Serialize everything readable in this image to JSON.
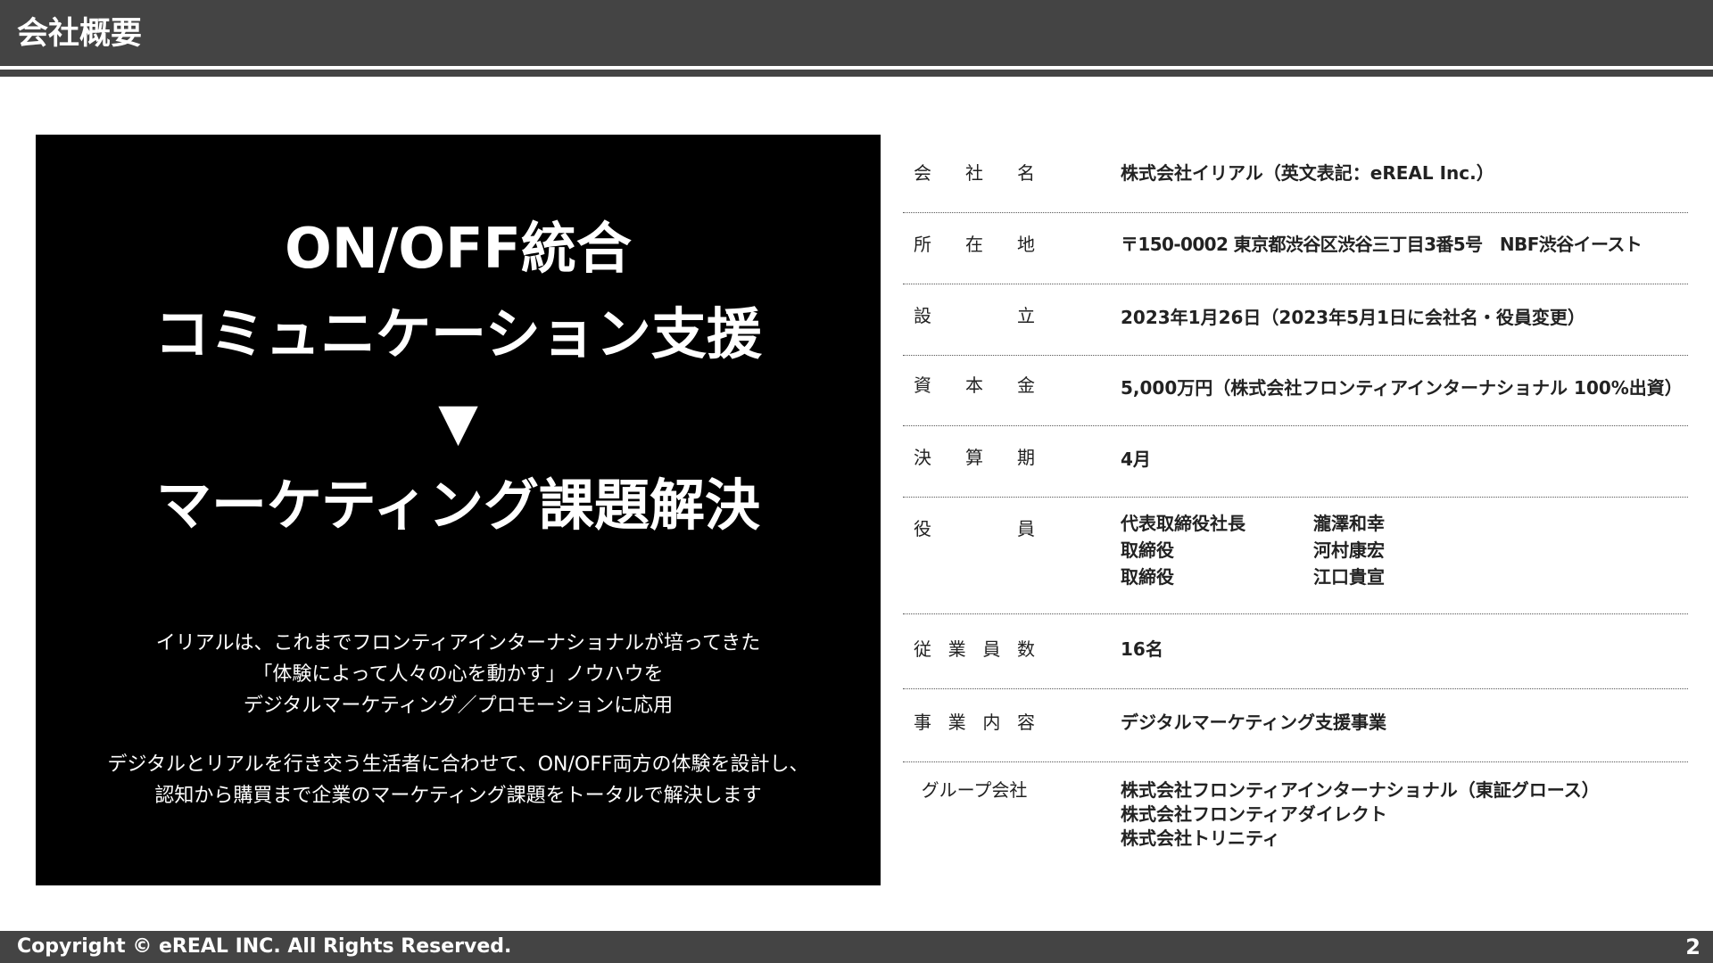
{
  "header": {
    "title": "会社概要"
  },
  "hero": {
    "headline_1": "ON/OFF統合",
    "headline_2": "コミュニケーション支援",
    "arrow": "▼",
    "headline_3": "マーケティング課題解決",
    "description": [
      "イリアルは、これまでフロンティアインターナショナルが培ってきた",
      "「体験によって人々の心を動かす」ノウハウを",
      "デジタルマーケティング／プロモーションに応用",
      "デジタルとリアルを行き交う生活者に合わせて、ON/OFF両方の体験を設計し、",
      "認知から購買まで企業のマーケティング課題をトータルで解決します"
    ]
  },
  "company_info": {
    "company_name": {
      "label": "会 社 名",
      "value": "株式会社イリアル（英文表記：eREAL Inc.）"
    },
    "address": {
      "label": "所 在 地",
      "value": "〒150-0002 東京都渋谷区渋谷三丁目3番5号　NBF渋谷イースト"
    },
    "established": {
      "label": "設 立",
      "value": "2023年1月26日（2023年5月1日に会社名・役員変更）"
    },
    "capital": {
      "label": "資 本 金",
      "value": "5,000万円（株式会社フロンティアインターナショナル 100%出資）"
    },
    "fiscal_period": {
      "label": "決 算 期",
      "value": "4月"
    },
    "officers": {
      "label": "役 員",
      "members": [
        {
          "role": "代表取締役社長",
          "name": "瀧澤和幸"
        },
        {
          "role": "取締役",
          "name": "河村康宏"
        },
        {
          "role": "取締役",
          "name": "江口貴宣"
        }
      ]
    },
    "employees": {
      "label": "従 業 員 数",
      "value": "16名"
    },
    "business": {
      "label": "事 業 内 容",
      "value": "デジタルマーケティング支援事業"
    },
    "group": {
      "label": "グループ会社",
      "companies": [
        "株式会社フロンティアインターナショナル（東証グロース）",
        "株式会社フロンティアダイレクト",
        "株式会社トリニティ"
      ]
    }
  },
  "footer": {
    "copyright": "Copyright © eREAL INC. All Rights Reserved.",
    "page_number": "2"
  }
}
